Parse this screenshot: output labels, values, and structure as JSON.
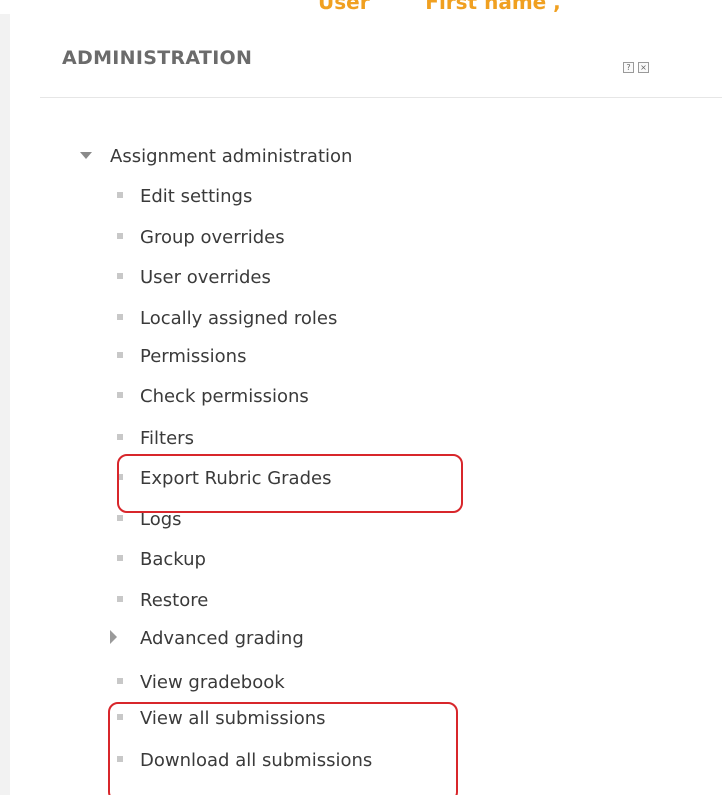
{
  "top_strip": {
    "text": "User        First name ,"
  },
  "block": {
    "title": "ADMINISTRATION",
    "controls": {
      "help_glyph": "?",
      "close_glyph": "×"
    }
  },
  "tree": {
    "root": {
      "label": "Assignment administration",
      "expanded": true
    },
    "items": [
      {
        "label": "Edit settings"
      },
      {
        "label": "Group overrides"
      },
      {
        "label": "User overrides"
      },
      {
        "label": "Locally assigned roles"
      },
      {
        "label": "Permissions"
      },
      {
        "label": "Check permissions"
      },
      {
        "label": "Filters"
      },
      {
        "label": "Export Rubric Grades"
      },
      {
        "label": "Logs"
      },
      {
        "label": "Backup"
      },
      {
        "label": "Restore"
      },
      {
        "label": "Advanced grading",
        "collapsible": true,
        "expanded": false
      },
      {
        "label": "View gradebook"
      },
      {
        "label": "View all submissions"
      },
      {
        "label": "Download all submissions"
      }
    ]
  },
  "annotations": {
    "highlight_color": "#d8262b"
  },
  "colors": {
    "title_text": "#6b6b6b",
    "item_text": "#3a3a3a",
    "bullet": "#c8c8c8",
    "top_text_accent": "#f0a020"
  }
}
